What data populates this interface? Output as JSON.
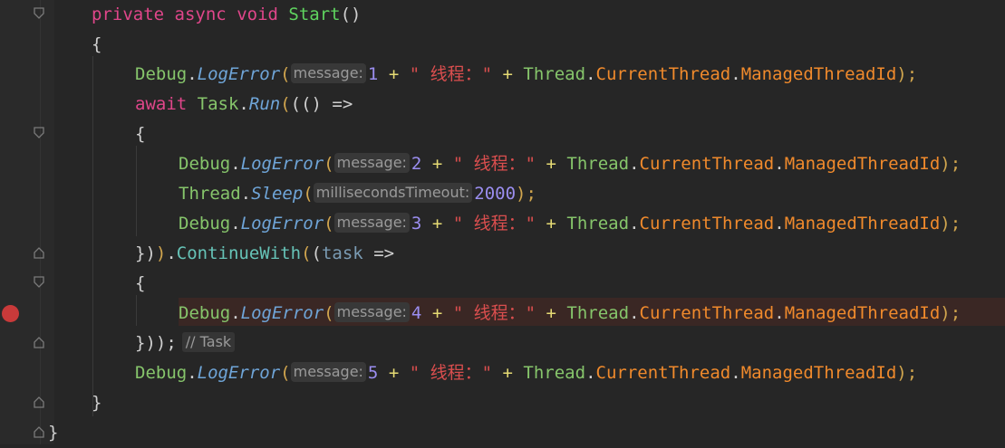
{
  "editor": {
    "language": "C#",
    "breakpoint_line": 11,
    "lines": [
      {
        "keyword_private": "private",
        "keyword_async": "async",
        "keyword_void": "void",
        "method": "Start",
        "parens": "()"
      },
      {
        "text": "{"
      },
      {
        "class": "Debug",
        "method": "LogError",
        "hint": "message:",
        "number": "1",
        "string": "\" 线程：\"",
        "thread": "Thread",
        "prop1": "CurrentThread",
        "prop2": "ManagedThreadId",
        "end": ");"
      },
      {
        "keyword": "await",
        "class": "Task",
        "method": "Run",
        "rest": "(() =>"
      },
      {
        "text": "{"
      },
      {
        "class": "Debug",
        "method": "LogError",
        "hint": "message:",
        "number": "2",
        "string": "\" 线程：\"",
        "thread": "Thread",
        "prop1": "CurrentThread",
        "prop2": "ManagedThreadId",
        "end": ");"
      },
      {
        "class": "Thread",
        "method": "Sleep",
        "hint": "millisecondsTimeout:",
        "number": "2000",
        "end": ");"
      },
      {
        "class": "Debug",
        "method": "LogError",
        "hint": "message:",
        "number": "3",
        "string": "\" 线程：\"",
        "thread": "Thread",
        "prop1": "CurrentThread",
        "prop2": "ManagedThreadId",
        "end": ");"
      },
      {
        "prefix": "})",
        "method": "ContinueWith",
        "param": "task",
        "arrow": "=>"
      },
      {
        "text": "{"
      },
      {
        "class": "Debug",
        "method": "LogError",
        "hint": "message:",
        "number": "4",
        "string": "\" 线程：\"",
        "thread": "Thread",
        "prop1": "CurrentThread",
        "prop2": "ManagedThreadId",
        "end": ");"
      },
      {
        "prefix": "}));",
        "comment": "// Task"
      },
      {
        "class": "Debug",
        "method": "LogError",
        "hint": "message:",
        "number": "5",
        "string": "\" 线程：\"",
        "thread": "Thread",
        "prop1": "CurrentThread",
        "prop2": "ManagedThreadId",
        "end": ");"
      },
      {
        "text": "}"
      },
      {
        "text": "}"
      }
    ]
  },
  "colors": {
    "background": "#262626",
    "keyword": "#e0468a",
    "method": "#5fd35f",
    "property": "#f08a2c",
    "number": "#9b8ef0",
    "string": "#d94e4e",
    "breakpoint": "#c93a3a",
    "highlight_row": "#3a2724"
  }
}
